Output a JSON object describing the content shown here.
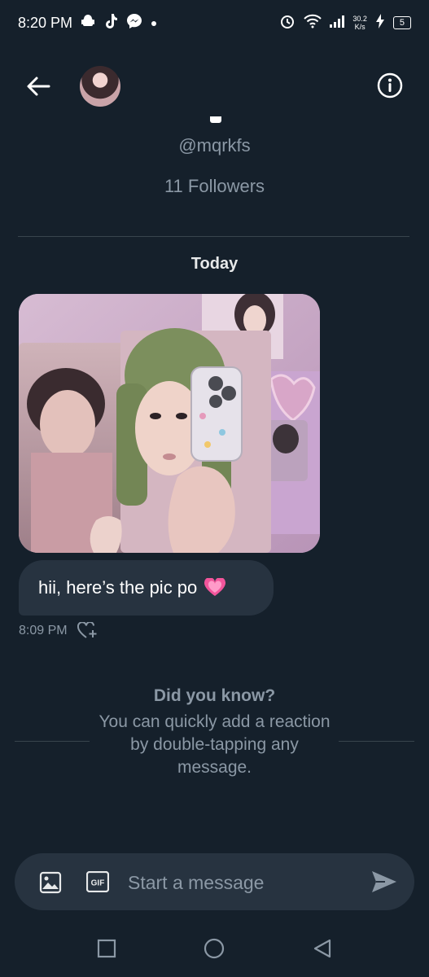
{
  "status_bar": {
    "time": "8:20 PM",
    "net_speed_value": "30.2",
    "net_speed_unit": "K/s",
    "battery": "5",
    "icons": [
      "android-icon",
      "tiktok-icon",
      "messenger-icon",
      "dot-icon",
      "alarm-icon",
      "wifi-icon",
      "signal-icon",
      "charging-icon",
      "battery-icon"
    ]
  },
  "header": {
    "icons": [
      "back-arrow-icon",
      "avatar",
      "info-icon"
    ]
  },
  "profile": {
    "handle": "@mqrkfs",
    "followers": "11 Followers"
  },
  "conversation": {
    "date_label": "Today",
    "messages": [
      {
        "type": "image",
        "image_desc_icon": "photo-attachment"
      },
      {
        "type": "text",
        "text": "hii, here’s the pic po",
        "emoji": "heart-emoji",
        "time": "8:09 PM",
        "action_icon": "add-reaction-icon"
      }
    ]
  },
  "tip": {
    "title": "Did you know?",
    "body": "You can quickly add a reaction by double-tapping any message."
  },
  "composer": {
    "placeholder": "Start a message",
    "gif_label": "GIF",
    "icons": [
      "image-icon",
      "gif-icon",
      "send-icon"
    ]
  },
  "nav_bar": {
    "icons": [
      "recent-apps-icon",
      "home-icon",
      "back-icon"
    ]
  },
  "colors": {
    "background": "#15202b",
    "bubble": "#273340",
    "muted_text": "#8b98a5",
    "divider": "#38444d"
  }
}
